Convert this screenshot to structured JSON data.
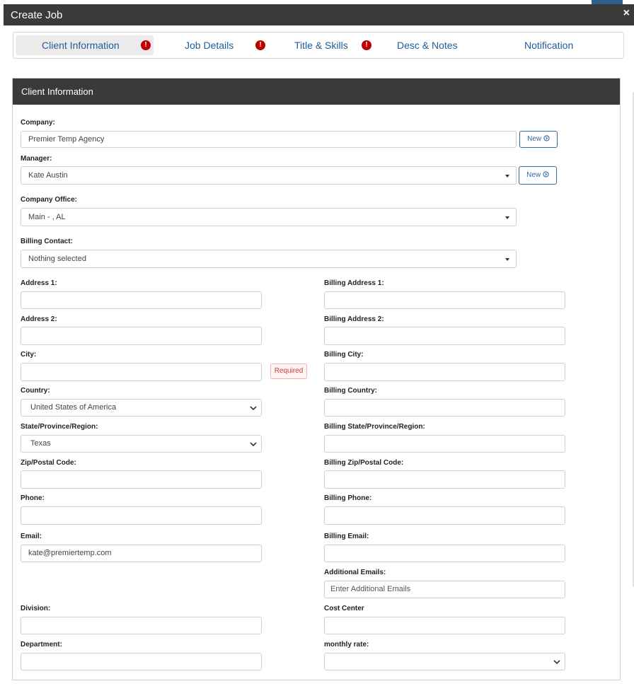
{
  "window": {
    "title": "Create Job",
    "close_label": "×"
  },
  "tabs": [
    {
      "label": "Client Information",
      "badge": "!"
    },
    {
      "label": "Job Details",
      "badge": "!"
    },
    {
      "label": "Title & Skills",
      "badge": "!"
    },
    {
      "label": "Desc & Notes"
    },
    {
      "label": "Notification"
    }
  ],
  "panel": {
    "title": "Client Information"
  },
  "form": {
    "company": {
      "label": "Company:",
      "value": "Premier Temp Agency",
      "new_label": "New"
    },
    "manager": {
      "label": "Manager:",
      "value": "Kate Austin",
      "new_label": "New"
    },
    "company_office": {
      "label": "Company Office:",
      "value": "Main - , AL"
    },
    "billing_contact": {
      "label": "Billing Contact:",
      "value": "Nothing selected"
    },
    "address1": {
      "label": "Address 1:",
      "value": ""
    },
    "address2": {
      "label": "Address 2:",
      "value": ""
    },
    "city": {
      "label": "City:",
      "value": "",
      "required_label": "Required"
    },
    "country": {
      "label": "Country:",
      "value": "United States of America"
    },
    "state": {
      "label": "State/Province/Region:",
      "value": "Texas"
    },
    "zip": {
      "label": "Zip/Postal Code:",
      "value": ""
    },
    "phone": {
      "label": "Phone:",
      "value": ""
    },
    "email": {
      "label": "Email:",
      "value": "kate@premiertemp.com"
    },
    "division": {
      "label": "Division:",
      "value": ""
    },
    "department": {
      "label": "Department:",
      "value": ""
    },
    "billing_address1": {
      "label": "Billing Address 1:",
      "value": ""
    },
    "billing_address2": {
      "label": "Billing Address 2:",
      "value": ""
    },
    "billing_city": {
      "label": "Billing City:",
      "value": ""
    },
    "billing_country": {
      "label": "Billing Country:",
      "value": ""
    },
    "billing_state": {
      "label": "Billing State/Province/Region:",
      "value": ""
    },
    "billing_zip": {
      "label": "Billing Zip/Postal Code:",
      "value": ""
    },
    "billing_phone": {
      "label": "Billing Phone:",
      "value": ""
    },
    "billing_email": {
      "label": "Billing Email:",
      "value": ""
    },
    "additional_emails": {
      "label": "Additional Emails:",
      "placeholder": "Enter Additional Emails"
    },
    "cost_center": {
      "label": "Cost Center",
      "value": ""
    },
    "monthly_rate": {
      "label": "monthly rate:",
      "value": ""
    }
  },
  "colors": {
    "header_bg": "#3a3a3a",
    "link_blue": "#1f5d99",
    "badge_red": "#c00000"
  }
}
